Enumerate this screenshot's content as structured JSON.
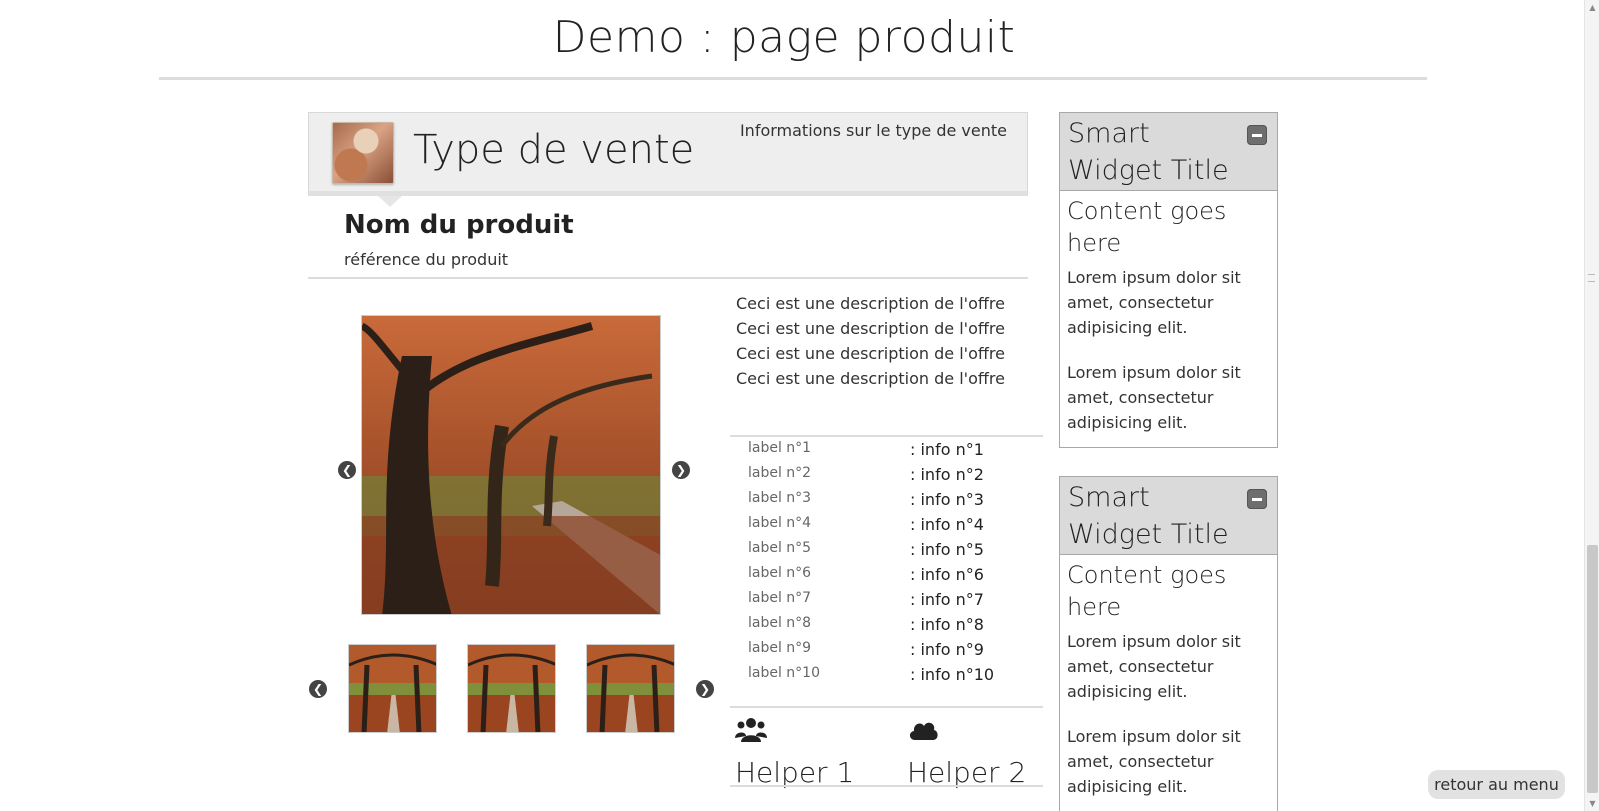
{
  "page": {
    "title": "Demo : page produit",
    "back_label": "retour au menu"
  },
  "sale": {
    "type_title": "Type de vente",
    "info_link": "Informations sur le type de vente"
  },
  "product": {
    "name": "Nom du produit",
    "reference": "référence du produit",
    "description": "Ceci est une description de l'offre Ceci est une description de l'offre Ceci est une description de l'offre Ceci est une description de l'offre"
  },
  "specs": [
    {
      "label": "label n°1",
      "value": ": info n°1"
    },
    {
      "label": "label n°2",
      "value": ": info n°2"
    },
    {
      "label": "label n°3",
      "value": ": info n°3"
    },
    {
      "label": "label n°4",
      "value": ": info n°4"
    },
    {
      "label": "label n°5",
      "value": ": info n°5"
    },
    {
      "label": "label n°6",
      "value": ": info n°6"
    },
    {
      "label": "label n°7",
      "value": ": info n°7"
    },
    {
      "label": "label n°8",
      "value": ": info n°8"
    },
    {
      "label": "label n°9",
      "value": ": info n°9"
    },
    {
      "label": "label n°10",
      "value": ": info n°10"
    }
  ],
  "helpers": [
    {
      "label": "Helper 1",
      "icon": "users-icon"
    },
    {
      "label": "Helper 2",
      "icon": "cloud-icon"
    }
  ],
  "widgets": [
    {
      "title": "Smart Widget Title",
      "heading": "Content goes here",
      "paragraphs": [
        "Lorem ipsum dolor sit amet, consectetur adipisicing elit.",
        "Lorem ipsum dolor sit amet, consectetur adipisicing elit."
      ]
    },
    {
      "title": "Smart Widget Title",
      "heading": "Content goes here",
      "paragraphs": [
        "Lorem ipsum dolor sit amet, consectetur adipisicing elit.",
        "Lorem ipsum dolor sit amet, consectetur adipisicing elit."
      ]
    }
  ],
  "icons": {
    "prev": "chevron-left-icon",
    "next": "chevron-right-icon",
    "collapse": "minus-icon"
  },
  "colors": {
    "header_bg": "#eeeeee",
    "widget_head_bg": "#dadada",
    "button_bg": "#e2e2e2"
  }
}
